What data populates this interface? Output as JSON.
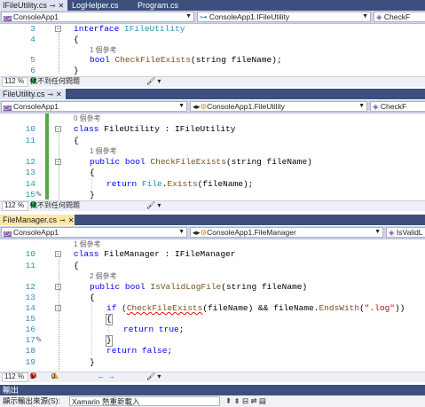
{
  "pane1": {
    "tabs": [
      {
        "label": "IFileUtility.cs",
        "active": true
      },
      {
        "label": "LogHelper.cs",
        "active": false
      },
      {
        "label": "Program.cs",
        "active": false
      }
    ],
    "nav": {
      "project": "ConsoleApp1",
      "type": "ConsoleApp1.IFileUtility",
      "member": "CheckF"
    },
    "lines": [
      {
        "n": "3",
        "refs": ""
      },
      {
        "n": "4",
        "refs": ""
      },
      {
        "n": "5",
        "refs": "1 個參考"
      },
      {
        "n": "6",
        "refs": ""
      }
    ],
    "code": {
      "l3_kw": "interface",
      "l3_name": "IFileUtility",
      "l4": "{",
      "l5_kw": "bool",
      "l5_method": "CheckFileExists",
      "l5_args": "(string fileName);",
      "l6": "}"
    },
    "status": {
      "zoom": "112 %",
      "issues": "找不到任何問題"
    }
  },
  "pane2": {
    "tab": {
      "label": "FileUtility.cs"
    },
    "nav": {
      "project": "ConsoleApp1",
      "type": "ConsoleApp1.FileUtility",
      "member": "CheckF"
    },
    "refs_class": "0 個參考",
    "refs_method": "1 個參考",
    "lines": [
      "10",
      "11",
      "12",
      "13",
      "14",
      "15"
    ],
    "code": {
      "l10_kw": "class",
      "l10_rest": "FileUtility : IFileUtility",
      "l11": "{",
      "l12_kw": "public bool",
      "l12_method": "CheckFileExists",
      "l12_args": "(string fileName)",
      "l13": "{",
      "l14_kw": "return",
      "l14_type": "File",
      "l14_method": "Exists",
      "l14_args": "(fileName);",
      "l15": "}"
    },
    "status": {
      "zoom": "112 %",
      "issues": "找不到任何問題"
    }
  },
  "pane3": {
    "tab": {
      "label": "FileManager.cs"
    },
    "nav": {
      "project": "ConsoleApp1",
      "type": "ConsoleApp1.FileManager",
      "member": "IsValidL"
    },
    "refs_class": "1 個參考",
    "refs_method": "2 個參考",
    "lines": [
      "10",
      "11",
      "12",
      "13",
      "14",
      "15",
      "16",
      "17",
      "18",
      "19"
    ],
    "code": {
      "l10_kw": "class",
      "l10_rest": "FileManager : IFileManager",
      "l11": "{",
      "l12_kw": "public bool",
      "l12_method": "IsValidLogFile",
      "l12_args": "(string fileName)",
      "l13": "{",
      "l14_if": "if (",
      "l14_call": "CheckFileExists",
      "l14_mid": "(fileName) && fileName.",
      "l14_method": "EndsWith",
      "l14_open": "(",
      "l14_str": "\".log\"",
      "l14_close": "))",
      "l15": "{",
      "l16_kw": "return",
      "l16_val": "true",
      "l17": "}",
      "l18_kw": "return",
      "l18_val": "false",
      "l19": "}"
    },
    "status": {
      "zoom": "112 %",
      "errors": "1",
      "warnings": "0"
    }
  },
  "output": {
    "title": "輸出",
    "source_label": "顯示輸出來源(S):",
    "source_value": "Xamarin 熱重新載入"
  }
}
